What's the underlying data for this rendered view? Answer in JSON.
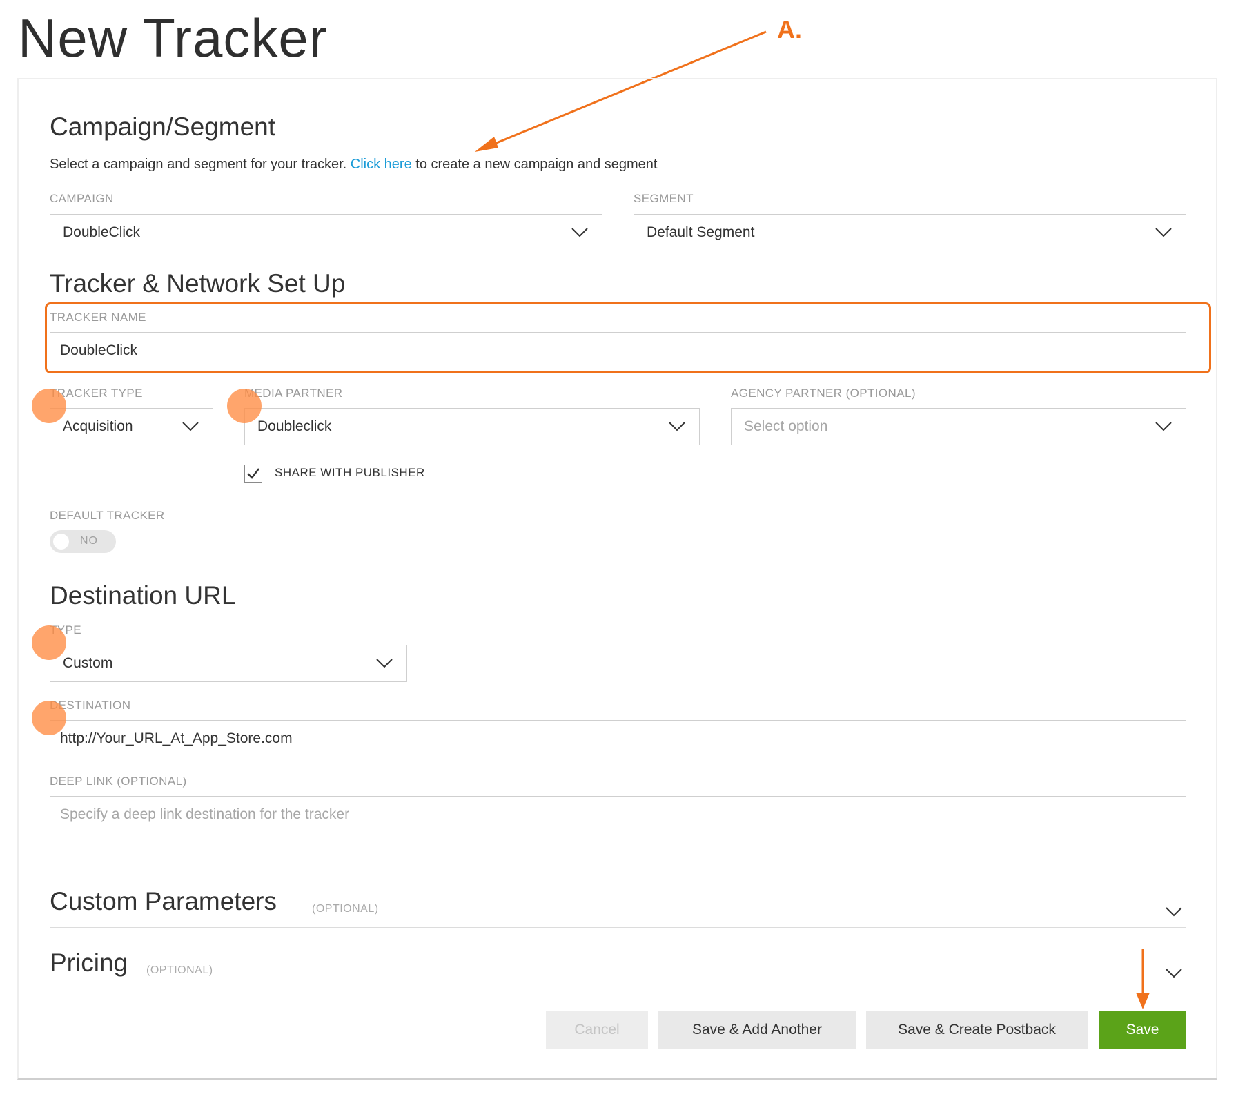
{
  "page": {
    "title": "New Tracker"
  },
  "annotations": {
    "letter": "A.",
    "color": "#f0711b"
  },
  "campaign_segment": {
    "title": "Campaign/Segment",
    "helper_text_before": "Select a campaign and segment for your tracker. ",
    "helper_link": "Click here",
    "helper_text_after": " to create a new campaign and segment",
    "campaign": {
      "label": "CAMPAIGN",
      "value": "DoubleClick"
    },
    "segment": {
      "label": "SEGMENT",
      "value": "Default Segment"
    }
  },
  "tracker_network": {
    "title": "Tracker & Network Set Up",
    "tracker_name": {
      "label": "TRACKER NAME",
      "value": "DoubleClick"
    },
    "tracker_type": {
      "label": "TRACKER TYPE",
      "value": "Acquisition"
    },
    "media_partner": {
      "label": "MEDIA PARTNER",
      "value": "Doubleclick"
    },
    "agency_partner": {
      "label": "AGENCY PARTNER (OPTIONAL)",
      "placeholder": "Select option"
    },
    "share_with_publisher": {
      "label": "SHARE WITH PUBLISHER",
      "checked": true
    },
    "default_tracker": {
      "label": "DEFAULT TRACKER",
      "toggle_text": "NO",
      "on": false
    }
  },
  "destination_url": {
    "title": "Destination URL",
    "type": {
      "label": "TYPE",
      "value": "Custom"
    },
    "destination": {
      "label": "DESTINATION",
      "value": "http://Your_URL_At_App_Store.com"
    },
    "deep_link": {
      "label": "DEEP LINK (OPTIONAL)",
      "placeholder": "Specify a deep link destination for the tracker"
    }
  },
  "custom_parameters": {
    "title": "Custom Parameters",
    "optional": "(OPTIONAL)"
  },
  "pricing": {
    "title": "Pricing",
    "optional": "(OPTIONAL)"
  },
  "buttons": {
    "cancel": "Cancel",
    "save_add_another": "Save & Add Another",
    "save_create_postback": "Save & Create Postback",
    "save": "Save"
  },
  "colors": {
    "accent": "#f0711b",
    "link": "#1a9bd7",
    "primary_button": "#5ba319"
  }
}
